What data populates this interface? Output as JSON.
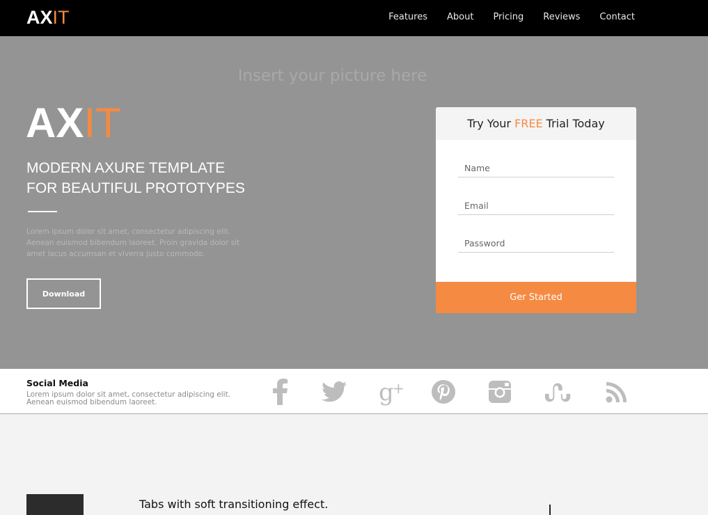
{
  "nav": {
    "brand_ax": "AX",
    "brand_it": "IT",
    "items": [
      "Features",
      "About",
      "Pricing",
      "Reviews",
      "Contact"
    ]
  },
  "hero": {
    "placeholder": "Insert your picture here",
    "logo_ax": "AX",
    "logo_it": "IT",
    "title_line1": "MODERN AXURE TEMPLATE",
    "title_line2": "FOR BEAUTIFUL PROTOTYPES",
    "description": "Lorem ipsum dolor sit amet, consectetur adipiscing elit. Aenean euismod bibendum laoreet. Proin gravida dolor sit amet lacus accumsan et viverra justo commodo.",
    "download_label": "Download"
  },
  "trial": {
    "heading_pre": "Try Your ",
    "heading_free": "FREE",
    "heading_post": " Trial Today",
    "fields": [
      "Name",
      "Email",
      "Password"
    ],
    "button_label": "Ger Started"
  },
  "social": {
    "title": "Social Media",
    "description": "Lorem ipsum dolor sit amet, consectetur adipiscing elit. Aenean euismod bibendum laoreet.",
    "icons": [
      "facebook-icon",
      "twitter-icon",
      "google-plus-icon",
      "pinterest-icon",
      "instagram-icon",
      "stumbleupon-icon",
      "rss-icon"
    ]
  },
  "features": {
    "tabs_title": "Tabs with soft transitioning effect."
  },
  "colors": {
    "accent": "#f58a42",
    "hero_bg": "#949494",
    "topbar_bg": "#000000"
  }
}
